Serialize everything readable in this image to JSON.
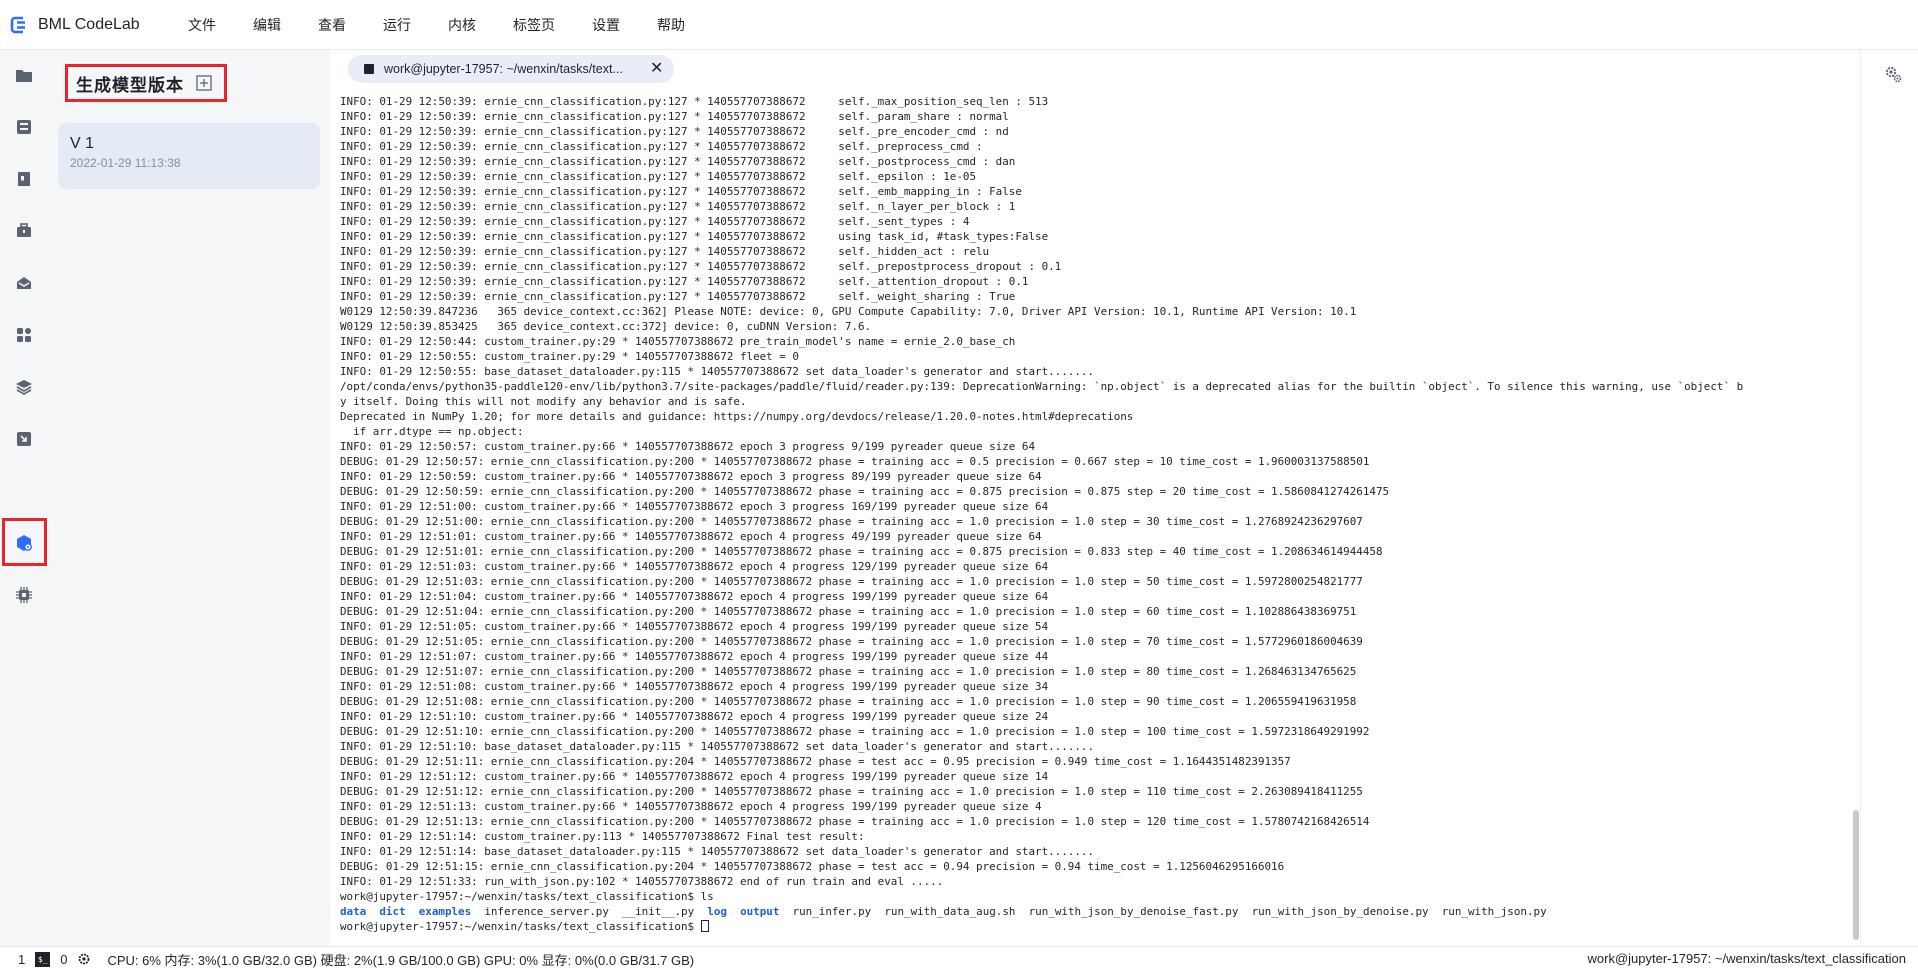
{
  "app": {
    "brand": "BML CodeLab"
  },
  "menu": [
    "文件",
    "编辑",
    "查看",
    "运行",
    "内核",
    "标签页",
    "设置",
    "帮助"
  ],
  "rail_icons": [
    "folder-icon",
    "archive-icon",
    "bookmark-icon",
    "toolbox-icon",
    "inbox-icon",
    "apps-icon",
    "layers-icon",
    "download-box-icon",
    "model-cube-icon",
    "chip-icon"
  ],
  "panel": {
    "title": "生成模型版本",
    "versions": [
      {
        "name": "V 1",
        "date": "2022-01-29 11:13:38"
      }
    ]
  },
  "tab": {
    "label": "work@jupyter-17957: ~/wenxin/tasks/text...",
    "close": "✕"
  },
  "terminal": {
    "lines": [
      "INFO: 01-29 12:50:39: ernie_cnn_classification.py:127 * 140557707388672     self._max_position_seq_len : 513",
      "INFO: 01-29 12:50:39: ernie_cnn_classification.py:127 * 140557707388672     self._param_share : normal",
      "INFO: 01-29 12:50:39: ernie_cnn_classification.py:127 * 140557707388672     self._pre_encoder_cmd : nd",
      "INFO: 01-29 12:50:39: ernie_cnn_classification.py:127 * 140557707388672     self._preprocess_cmd :",
      "INFO: 01-29 12:50:39: ernie_cnn_classification.py:127 * 140557707388672     self._postprocess_cmd : dan",
      "INFO: 01-29 12:50:39: ernie_cnn_classification.py:127 * 140557707388672     self._epsilon : 1e-05",
      "INFO: 01-29 12:50:39: ernie_cnn_classification.py:127 * 140557707388672     self._emb_mapping_in : False",
      "INFO: 01-29 12:50:39: ernie_cnn_classification.py:127 * 140557707388672     self._n_layer_per_block : 1",
      "INFO: 01-29 12:50:39: ernie_cnn_classification.py:127 * 140557707388672     self._sent_types : 4",
      "INFO: 01-29 12:50:39: ernie_cnn_classification.py:127 * 140557707388672     using task_id, #task_types:False",
      "INFO: 01-29 12:50:39: ernie_cnn_classification.py:127 * 140557707388672     self._hidden_act : relu",
      "INFO: 01-29 12:50:39: ernie_cnn_classification.py:127 * 140557707388672     self._prepostprocess_dropout : 0.1",
      "INFO: 01-29 12:50:39: ernie_cnn_classification.py:127 * 140557707388672     self._attention_dropout : 0.1",
      "INFO: 01-29 12:50:39: ernie_cnn_classification.py:127 * 140557707388672     self._weight_sharing : True",
      "W0129 12:50:39.847236   365 device_context.cc:362] Please NOTE: device: 0, GPU Compute Capability: 7.0, Driver API Version: 10.1, Runtime API Version: 10.1",
      "W0129 12:50:39.853425   365 device_context.cc:372] device: 0, cuDNN Version: 7.6.",
      "INFO: 01-29 12:50:44: custom_trainer.py:29 * 140557707388672 pre_train_model's name = ernie_2.0_base_ch",
      "INFO: 01-29 12:50:55: custom_trainer.py:29 * 140557707388672 fleet = 0",
      "INFO: 01-29 12:50:55: base_dataset_dataloader.py:115 * 140557707388672 set data_loader's generator and start.......",
      "/opt/conda/envs/python35-paddle120-env/lib/python3.7/site-packages/paddle/fluid/reader.py:139: DeprecationWarning: `np.object` is a deprecated alias for the builtin `object`. To silence this warning, use `object` b",
      "y itself. Doing this will not modify any behavior and is safe.",
      "Deprecated in NumPy 1.20; for more details and guidance: https://numpy.org/devdocs/release/1.20.0-notes.html#deprecations",
      "  if arr.dtype == np.object:",
      "INFO: 01-29 12:50:57: custom_trainer.py:66 * 140557707388672 epoch 3 progress 9/199 pyreader queue size 64",
      "DEBUG: 01-29 12:50:57: ernie_cnn_classification.py:200 * 140557707388672 phase = training acc = 0.5 precision = 0.667 step = 10 time_cost = 1.960003137588501",
      "INFO: 01-29 12:50:59: custom_trainer.py:66 * 140557707388672 epoch 3 progress 89/199 pyreader queue size 64",
      "DEBUG: 01-29 12:50:59: ernie_cnn_classification.py:200 * 140557707388672 phase = training acc = 0.875 precision = 0.875 step = 20 time_cost = 1.5860841274261475",
      "INFO: 01-29 12:51:00: custom_trainer.py:66 * 140557707388672 epoch 3 progress 169/199 pyreader queue size 64",
      "DEBUG: 01-29 12:51:00: ernie_cnn_classification.py:200 * 140557707388672 phase = training acc = 1.0 precision = 1.0 step = 30 time_cost = 1.2768924236297607",
      "INFO: 01-29 12:51:01: custom_trainer.py:66 * 140557707388672 epoch 4 progress 49/199 pyreader queue size 64",
      "DEBUG: 01-29 12:51:01: ernie_cnn_classification.py:200 * 140557707388672 phase = training acc = 0.875 precision = 0.833 step = 40 time_cost = 1.208634614944458",
      "INFO: 01-29 12:51:03: custom_trainer.py:66 * 140557707388672 epoch 4 progress 129/199 pyreader queue size 64",
      "DEBUG: 01-29 12:51:03: ernie_cnn_classification.py:200 * 140557707388672 phase = training acc = 1.0 precision = 1.0 step = 50 time_cost = 1.5972800254821777",
      "INFO: 01-29 12:51:04: custom_trainer.py:66 * 140557707388672 epoch 4 progress 199/199 pyreader queue size 64",
      "DEBUG: 01-29 12:51:04: ernie_cnn_classification.py:200 * 140557707388672 phase = training acc = 1.0 precision = 1.0 step = 60 time_cost = 1.102886438369751",
      "INFO: 01-29 12:51:05: custom_trainer.py:66 * 140557707388672 epoch 4 progress 199/199 pyreader queue size 54",
      "DEBUG: 01-29 12:51:05: ernie_cnn_classification.py:200 * 140557707388672 phase = training acc = 1.0 precision = 1.0 step = 70 time_cost = 1.5772960186004639",
      "INFO: 01-29 12:51:07: custom_trainer.py:66 * 140557707388672 epoch 4 progress 199/199 pyreader queue size 44",
      "DEBUG: 01-29 12:51:07: ernie_cnn_classification.py:200 * 140557707388672 phase = training acc = 1.0 precision = 1.0 step = 80 time_cost = 1.268463134765625",
      "INFO: 01-29 12:51:08: custom_trainer.py:66 * 140557707388672 epoch 4 progress 199/199 pyreader queue size 34",
      "DEBUG: 01-29 12:51:08: ernie_cnn_classification.py:200 * 140557707388672 phase = training acc = 1.0 precision = 1.0 step = 90 time_cost = 1.206559419631958",
      "INFO: 01-29 12:51:10: custom_trainer.py:66 * 140557707388672 epoch 4 progress 199/199 pyreader queue size 24",
      "DEBUG: 01-29 12:51:10: ernie_cnn_classification.py:200 * 140557707388672 phase = training acc = 1.0 precision = 1.0 step = 100 time_cost = 1.5972318649291992",
      "INFO: 01-29 12:51:10: base_dataset_dataloader.py:115 * 140557707388672 set data_loader's generator and start.......",
      "DEBUG: 01-29 12:51:11: ernie_cnn_classification.py:204 * 140557707388672 phase = test acc = 0.95 precision = 0.949 time_cost = 1.1644351482391357",
      "INFO: 01-29 12:51:12: custom_trainer.py:66 * 140557707388672 epoch 4 progress 199/199 pyreader queue size 14",
      "DEBUG: 01-29 12:51:12: ernie_cnn_classification.py:200 * 140557707388672 phase = training acc = 1.0 precision = 1.0 step = 110 time_cost = 2.263089418411255",
      "INFO: 01-29 12:51:13: custom_trainer.py:66 * 140557707388672 epoch 4 progress 199/199 pyreader queue size 4",
      "DEBUG: 01-29 12:51:13: ernie_cnn_classification.py:200 * 140557707388672 phase = training acc = 1.0 precision = 1.0 step = 120 time_cost = 1.5780742168426514",
      "INFO: 01-29 12:51:14: custom_trainer.py:113 * 140557707388672 Final test result:",
      "INFO: 01-29 12:51:14: base_dataset_dataloader.py:115 * 140557707388672 set data_loader's generator and start.......",
      "DEBUG: 01-29 12:51:15: ernie_cnn_classification.py:204 * 140557707388672 phase = test acc = 0.94 precision = 0.94 time_cost = 1.1256046295166016",
      "INFO: 01-29 12:51:33: run_with_json.py:102 * 140557707388672 end of run train and eval .....",
      "work@jupyter-17957:~/wenxin/tasks/text_classification$ ls"
    ],
    "ls_output": [
      {
        "name": "data",
        "dir": true
      },
      {
        "name": "dict",
        "dir": true
      },
      {
        "name": "examples",
        "dir": true
      },
      {
        "name": "inference_server.py",
        "dir": false
      },
      {
        "name": "__init__.py",
        "dir": false
      },
      {
        "name": "log",
        "dir": true
      },
      {
        "name": "output",
        "dir": true
      },
      {
        "name": "run_infer.py",
        "dir": false
      },
      {
        "name": "run_with_data_aug.sh",
        "dir": false
      },
      {
        "name": "run_with_json_by_denoise_fast.py",
        "dir": false
      },
      {
        "name": "run_with_json_by_denoise.py",
        "dir": false
      },
      {
        "name": "run_with_json.py",
        "dir": false
      }
    ],
    "prompt": "work@jupyter-17957:~/wenxin/tasks/text_classification$ "
  },
  "status": {
    "count1": "1",
    "count2": "0",
    "resources": "CPU:  6% 内存:  3%(1.0 GB/32.0 GB)  硬盘:  2%(1.9 GB/100.0 GB)  GPU:  0%  显存:  0%(0.0 GB/31.7 GB)",
    "path": "work@jupyter-17957: ~/wenxin/tasks/text_classification"
  },
  "colors": {
    "accent_red": "#e8242c",
    "brand_blue": "#2f6bff",
    "dir_blue": "#1c5fd6"
  }
}
